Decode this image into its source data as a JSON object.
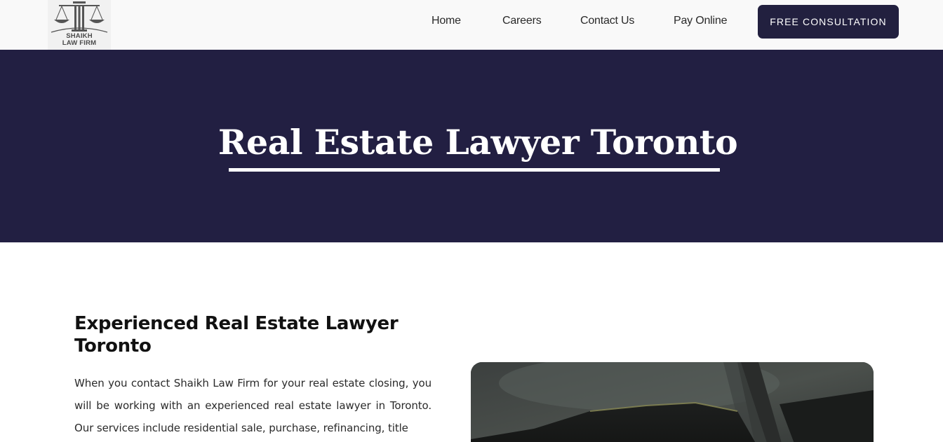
{
  "header": {
    "logo": {
      "line1": "SHAIKH",
      "line2": "LAW FIRM",
      "icon": "scales-of-justice-icon"
    },
    "nav": {
      "home": "Home",
      "careers": "Careers",
      "contact": "Contact Us",
      "pay": "Pay Online"
    },
    "cta_label": "FREE CONSULTATION"
  },
  "hero": {
    "title": "Real Estate Lawyer Toronto"
  },
  "content": {
    "heading": "Experienced Real Estate Lawyer Toronto",
    "paragraph": "When you contact Shaikh Law Firm for your real estate closing, you will be working with an experienced real estate lawyer in Toronto. Our services include residential sale, purchase, refinancing, title"
  },
  "colors": {
    "brand_navy": "#221f42",
    "header_bg": "#f9f9f9",
    "cta_bg": "#22203f",
    "text_dark": "#111111"
  }
}
